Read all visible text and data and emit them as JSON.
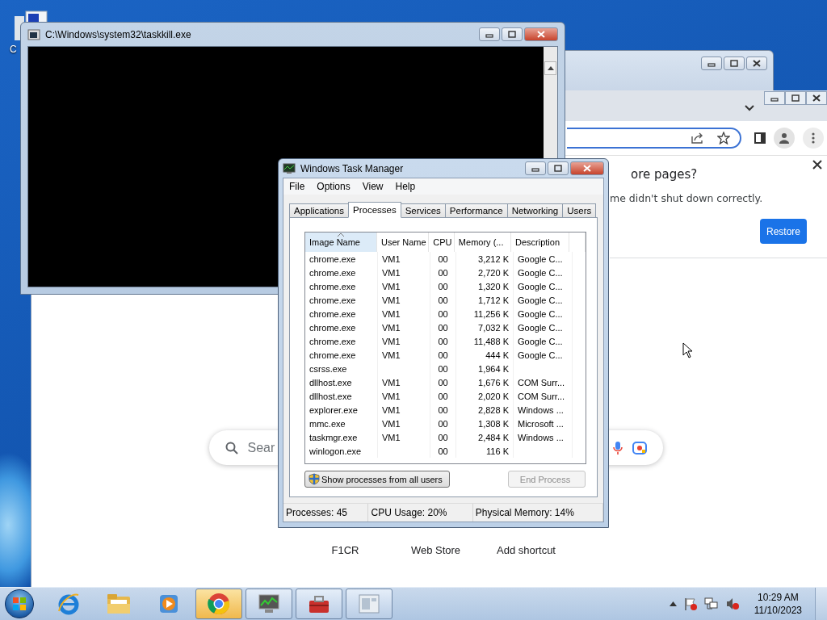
{
  "desktop": {
    "icons": [
      {
        "label": "C"
      }
    ]
  },
  "console_window": {
    "title": "C:\\Windows\\system32\\taskkill.exe"
  },
  "browser": {
    "restore_prompt": {
      "title": "ore pages?",
      "message": "me didn't shut down correctly.",
      "button": "Restore"
    },
    "search": {
      "placeholder": "Sear"
    },
    "shortcuts": [
      {
        "label": "F1CR"
      },
      {
        "label": "Web Store"
      },
      {
        "label": "Add shortcut"
      }
    ]
  },
  "task_manager": {
    "title": "Windows Task Manager",
    "menu": [
      "File",
      "Options",
      "View",
      "Help"
    ],
    "tabs": [
      {
        "label": "Applications",
        "selected": false
      },
      {
        "label": "Processes",
        "selected": true
      },
      {
        "label": "Services",
        "selected": false
      },
      {
        "label": "Performance",
        "selected": false
      },
      {
        "label": "Networking",
        "selected": false
      },
      {
        "label": "Users",
        "selected": false
      }
    ],
    "table": {
      "columns": [
        {
          "label": "Image Name",
          "sorted": true
        },
        {
          "label": "User Name",
          "sorted": false
        },
        {
          "label": "CPU",
          "sorted": false
        },
        {
          "label": "Memory (...",
          "sorted": false
        },
        {
          "label": "Description",
          "sorted": false
        }
      ],
      "rows": [
        {
          "image_name": "chrome.exe",
          "user_name": "VM1",
          "cpu": "00",
          "memory": "3,212 K",
          "description": "Google C..."
        },
        {
          "image_name": "chrome.exe",
          "user_name": "VM1",
          "cpu": "00",
          "memory": "2,720 K",
          "description": "Google C..."
        },
        {
          "image_name": "chrome.exe",
          "user_name": "VM1",
          "cpu": "00",
          "memory": "1,320 K",
          "description": "Google C..."
        },
        {
          "image_name": "chrome.exe",
          "user_name": "VM1",
          "cpu": "00",
          "memory": "1,712 K",
          "description": "Google C..."
        },
        {
          "image_name": "chrome.exe",
          "user_name": "VM1",
          "cpu": "00",
          "memory": "11,256 K",
          "description": "Google C..."
        },
        {
          "image_name": "chrome.exe",
          "user_name": "VM1",
          "cpu": "00",
          "memory": "7,032 K",
          "description": "Google C..."
        },
        {
          "image_name": "chrome.exe",
          "user_name": "VM1",
          "cpu": "00",
          "memory": "11,488 K",
          "description": "Google C..."
        },
        {
          "image_name": "chrome.exe",
          "user_name": "VM1",
          "cpu": "00",
          "memory": "444 K",
          "description": "Google C..."
        },
        {
          "image_name": "csrss.exe",
          "cpu": "00",
          "memory": "1,964 K"
        },
        {
          "image_name": "dllhost.exe",
          "user_name": "VM1",
          "cpu": "00",
          "memory": "1,676 K",
          "description": "COM Surr..."
        },
        {
          "image_name": "dllhost.exe",
          "user_name": "VM1",
          "cpu": "00",
          "memory": "2,020 K",
          "description": "COM Surr..."
        },
        {
          "image_name": "explorer.exe",
          "user_name": "VM1",
          "cpu": "00",
          "memory": "2,828 K",
          "description": "Windows ..."
        },
        {
          "image_name": "mmc.exe",
          "user_name": "VM1",
          "cpu": "00",
          "memory": "1,308 K",
          "description": "Microsoft ..."
        },
        {
          "image_name": "taskmgr.exe",
          "user_name": "VM1",
          "cpu": "00",
          "memory": "2,484 K",
          "description": "Windows ..."
        },
        {
          "image_name": "winlogon.exe",
          "cpu": "00",
          "memory": "116 K"
        }
      ]
    },
    "buttons": [
      {
        "label": "Show processes from all users",
        "disabled": false,
        "kind": "shield"
      },
      {
        "label": "End Process",
        "disabled": true,
        "kind": "plain"
      }
    ],
    "status_bar": [
      "Processes: 45",
      "CPU Usage: 20%",
      "Physical Memory: 14%"
    ]
  },
  "taskbar": {
    "apps": [
      {
        "kind": "ie",
        "running": false,
        "highlighted": false
      },
      {
        "kind": "folder",
        "running": false,
        "highlighted": false
      },
      {
        "kind": "media",
        "running": false,
        "highlighted": false
      },
      {
        "kind": "chrome",
        "running": true,
        "highlighted": true
      },
      {
        "kind": "monitor",
        "running": true,
        "highlighted": false
      },
      {
        "kind": "toolbox",
        "running": true,
        "highlighted": false
      },
      {
        "kind": "window",
        "running": true,
        "highlighted": false
      }
    ],
    "clock": {
      "time": "10:29 AM",
      "date": "11/10/2023"
    }
  }
}
